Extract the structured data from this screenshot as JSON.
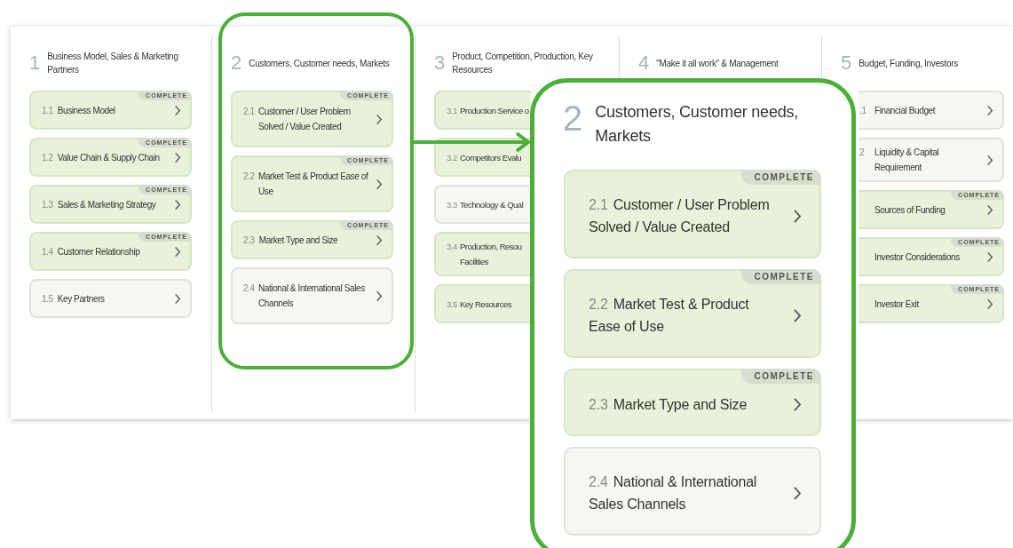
{
  "columns": [
    {
      "number": "1",
      "title": "Business Model, Sales & Marketing Partners",
      "cards": [
        {
          "number": "1.1",
          "label": "Business Model",
          "complete": true,
          "badge": "COMPLETE"
        },
        {
          "number": "1.2",
          "label": "Value Chain & Supply Chain",
          "complete": true,
          "badge": "COMPLETE"
        },
        {
          "number": "1.3",
          "label": "Sales & Marketing Strategy",
          "complete": true,
          "badge": "COMPLETE"
        },
        {
          "number": "1.4",
          "label": "Customer Relationship",
          "complete": true,
          "badge": "COMPLETE"
        },
        {
          "number": "1.5",
          "label": "Key Partners",
          "complete": false
        }
      ]
    },
    {
      "number": "2",
      "title": "Customers, Customer needs, Markets",
      "cards": [
        {
          "number": "2.1",
          "label": "Customer / User Problem Solved / Value Created",
          "complete": true,
          "badge": "COMPLETE"
        },
        {
          "number": "2.2",
          "label": "Market Test & Product Ease of Use",
          "complete": true,
          "badge": "COMPLETE"
        },
        {
          "number": "2.3",
          "label": "Market Type and Size",
          "complete": true,
          "badge": "COMPLETE"
        },
        {
          "number": "2.4",
          "label": "National & International Sales Channels",
          "complete": false
        }
      ]
    },
    {
      "number": "3",
      "title": "Product, Competition, Production, Key Resources",
      "clipped_right": true,
      "cards": [
        {
          "number": "3.1",
          "label": "Production Service o",
          "complete": true
        },
        {
          "number": "3.2",
          "label": "Competitors Evalu",
          "complete": true
        },
        {
          "number": "3.3",
          "label": "Technology & Qual",
          "complete": false
        },
        {
          "number": "3.4",
          "label": "Production, Resou Facilities",
          "complete": true
        },
        {
          "number": "3.5",
          "label": "Key Resources",
          "complete": true
        }
      ]
    },
    {
      "number": "4",
      "title": "\"Make it all work\" & Management"
    },
    {
      "number": "5",
      "title": "Budget, Funding, Investors",
      "clipped_left": true,
      "cards": [
        {
          "number": ".1",
          "label": "Financial Budget",
          "complete": false
        },
        {
          "number": "2",
          "label": "Liquidity & Capital Requirement",
          "complete": false
        },
        {
          "label": "Sources of Funding",
          "complete": true,
          "badge": "COMPLETE"
        },
        {
          "label": "Investor Considerations",
          "complete": true,
          "badge": "COMPLETE"
        },
        {
          "label": "Investor Exit",
          "complete": true,
          "badge": "COMPLETE"
        }
      ]
    }
  ],
  "callout": {
    "number": "2",
    "title": "Customers, Customer needs, Markets",
    "cards": [
      {
        "number": "2.1",
        "label": "Customer / User Problem Solved / Value Created",
        "complete": true,
        "badge": "COMPLETE"
      },
      {
        "number": "2.2",
        "label": "Market Test & Product Ease of Use",
        "complete": true,
        "badge": "COMPLETE"
      },
      {
        "number": "2.3",
        "label": "Market Type and Size",
        "complete": true,
        "badge": "COMPLETE"
      },
      {
        "number": "2.4",
        "label": "National & International Sales Channels",
        "complete": false
      }
    ]
  }
}
